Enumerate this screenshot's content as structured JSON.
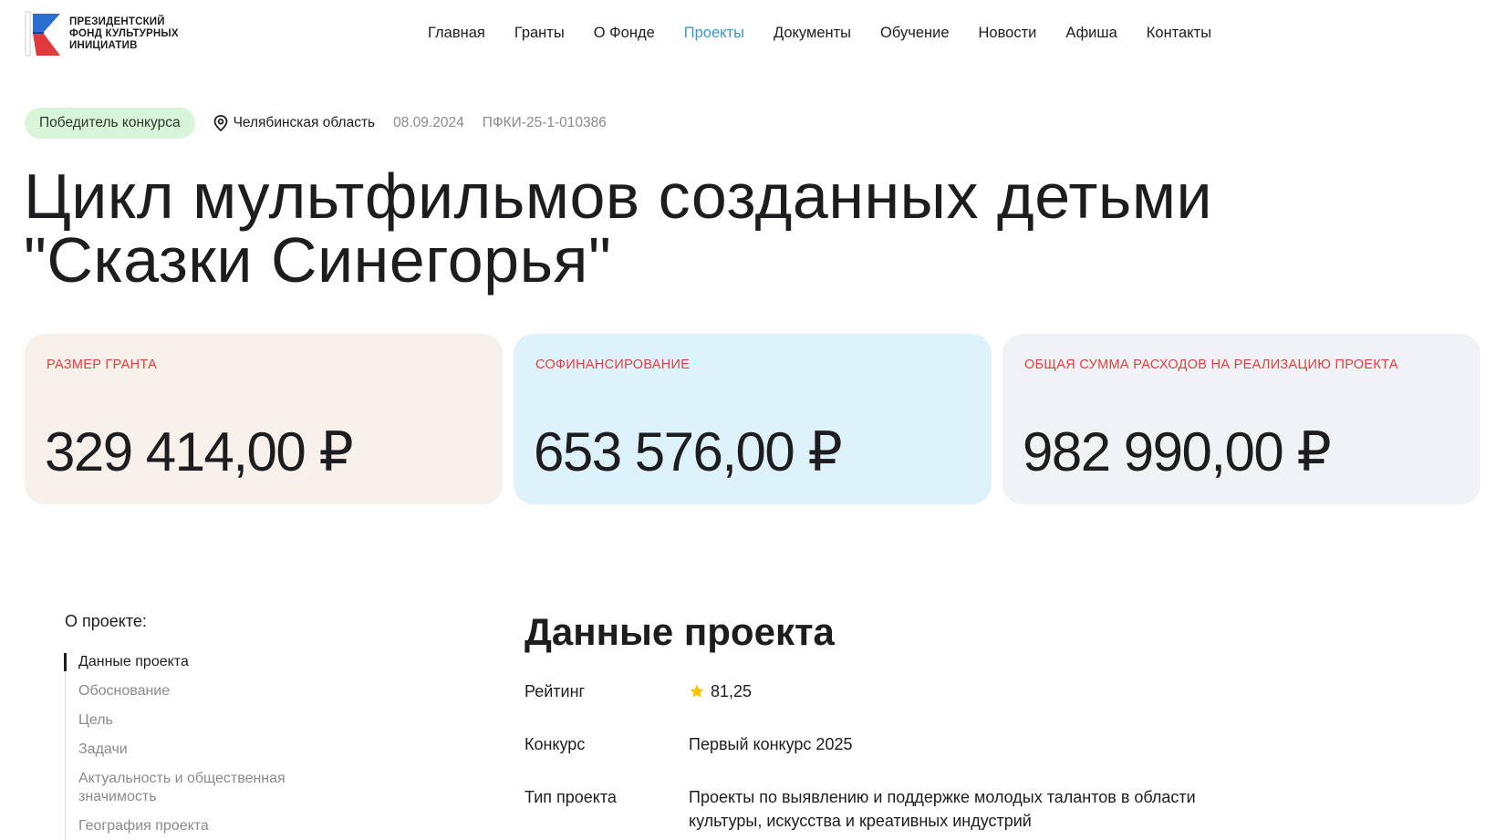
{
  "header": {
    "logo": {
      "line1": "ПРЕЗИДЕНТСКИЙ",
      "line2": "ФОНД КУЛЬТУРНЫХ",
      "line3": "ИНИЦИАТИВ",
      "icon": "pfki-logo-icon"
    },
    "nav": [
      {
        "label": "Главная",
        "active": false
      },
      {
        "label": "Гранты",
        "active": false
      },
      {
        "label": "О Фонде",
        "active": false
      },
      {
        "label": "Проекты",
        "active": true
      },
      {
        "label": "Документы",
        "active": false
      },
      {
        "label": "Обучение",
        "active": false
      },
      {
        "label": "Новости",
        "active": false
      },
      {
        "label": "Афиша",
        "active": false
      },
      {
        "label": "Контакты",
        "active": false
      }
    ]
  },
  "meta": {
    "badge": "Победитель конкурса",
    "region": "Челябинская область",
    "region_icon": "location-pin-icon",
    "date": "08.09.2024",
    "code": "ПФКИ-25-1-010386"
  },
  "title": {
    "line1": "Цикл мультфильмов созданных детьми",
    "line2": "\"Сказки Синегорья\""
  },
  "cards": [
    {
      "label": "РАЗМЕР ГРАНТА",
      "value": "329 414,00 ₽"
    },
    {
      "label": "СОФИНАНСИРОВАНИЕ",
      "value": "653 576,00 ₽"
    },
    {
      "label": "ОБЩАЯ СУММА РАСХОДОВ НА РЕАЛИЗАЦИЮ ПРОЕКТА",
      "value": "982 990,00 ₽"
    }
  ],
  "sidebar": {
    "title": "О проекте:",
    "items": [
      {
        "label": "Данные проекта",
        "active": true
      },
      {
        "label": "Обоснование",
        "active": false
      },
      {
        "label": "Цель",
        "active": false
      },
      {
        "label": "Задачи",
        "active": false
      },
      {
        "label": "Актуальность и общественная значимость",
        "active": false
      },
      {
        "label": "География проекта",
        "active": false
      }
    ]
  },
  "project_data": {
    "title": "Данные проекта",
    "rows": [
      {
        "label": "Рейтинг",
        "value": "81,25",
        "icon": "star-icon"
      },
      {
        "label": "Конкурс",
        "value": "Первый конкурс 2025"
      },
      {
        "label": "Тип проекта",
        "value": "Проекты по выявлению и поддержке молодых талантов в области культуры, искусства и креативных индустрий"
      }
    ]
  },
  "colors": {
    "accent_nav": "#3a97c9",
    "card_label": "#e0403a",
    "badge_bg": "#d9f5d9",
    "star": "#f7c300"
  }
}
